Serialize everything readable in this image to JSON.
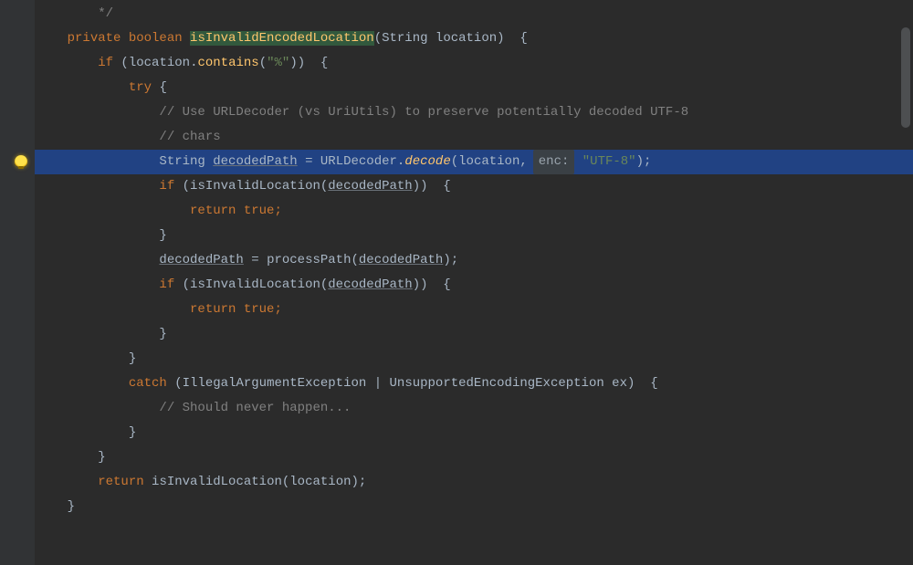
{
  "bulb_icon": "lightbulb-icon",
  "code": {
    "l0_comment": " */",
    "l1_kw_private": "private",
    "l1_kw_boolean": "boolean",
    "l1_method": "isInvalidEncodedLocation",
    "l1_param_type": "String",
    "l1_param_name": "location",
    "l2_kw_if": "if",
    "l2_call_obj": "location",
    "l2_call_method": "contains",
    "l2_string": "\"%\"",
    "l3_kw_try": "try",
    "l4_comment": "// Use URLDecoder (vs UriUtils) to preserve potentially decoded UTF-8",
    "l5_comment": "// chars",
    "l6_type": "String",
    "l6_var": "decodedPath",
    "l6_eq": " = ",
    "l6_class": "URLDecoder",
    "l6_method": "decode",
    "l6_arg": "location",
    "l6_hint_label": "enc:",
    "l6_hint_value": " \"UTF-8\"",
    "l7_kw_if": "if",
    "l7_call": "isInvalidLocation",
    "l7_arg": "decodedPath",
    "l8_kw_return": "return true",
    "l9_brace": "}",
    "l10_lhs": "decodedPath",
    "l10_eq": " = ",
    "l10_method": "processPath",
    "l10_arg": "decodedPath",
    "l11_kw_if": "if",
    "l11_call": "isInvalidLocation",
    "l11_arg": "decodedPath",
    "l12_kw_return": "return true",
    "l13_brace": "}",
    "l14_brace": "}",
    "l15_kw_catch": "catch",
    "l15_ex1": "IllegalArgumentException",
    "l15_ex2": "UnsupportedEncodingException",
    "l15_exvar": "ex",
    "l16_comment": "// Should never happen...",
    "l17_brace": "}",
    "l18_brace": "}",
    "l19_kw_return": "return",
    "l19_call": "isInvalidLocation",
    "l19_arg": "location",
    "l20_brace": "}"
  }
}
